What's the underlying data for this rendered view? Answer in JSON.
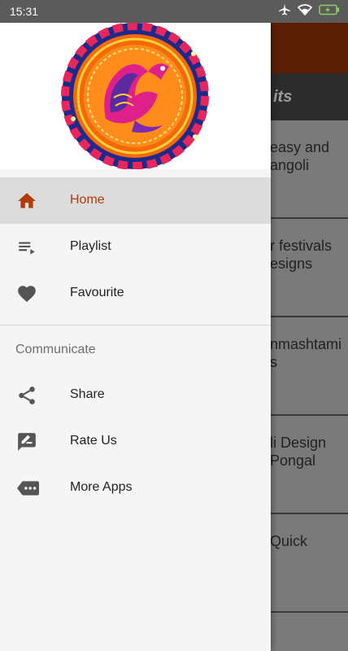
{
  "status_bar": {
    "time": "15:31"
  },
  "background": {
    "subbar_title": "its",
    "items": [
      "easy and\nangoli",
      "r festivals\nesigns",
      "nmashtami\ns",
      "li Design\nPongal",
      "Quick"
    ]
  },
  "drawer": {
    "nav_items": [
      {
        "label": "Home",
        "icon": "home-icon",
        "active": true
      },
      {
        "label": "Playlist",
        "icon": "playlist-icon",
        "active": false
      },
      {
        "label": "Favourite",
        "icon": "heart-icon",
        "active": false
      }
    ],
    "section_title": "Communicate",
    "communicate_items": [
      {
        "label": "Share",
        "icon": "share-icon"
      },
      {
        "label": "Rate Us",
        "icon": "rate-icon"
      },
      {
        "label": "More Apps",
        "icon": "more-apps-icon"
      }
    ]
  },
  "colors": {
    "accent": "#b23a0b",
    "appbar": "#5a1e05",
    "active_bg": "#dcdcdc"
  }
}
